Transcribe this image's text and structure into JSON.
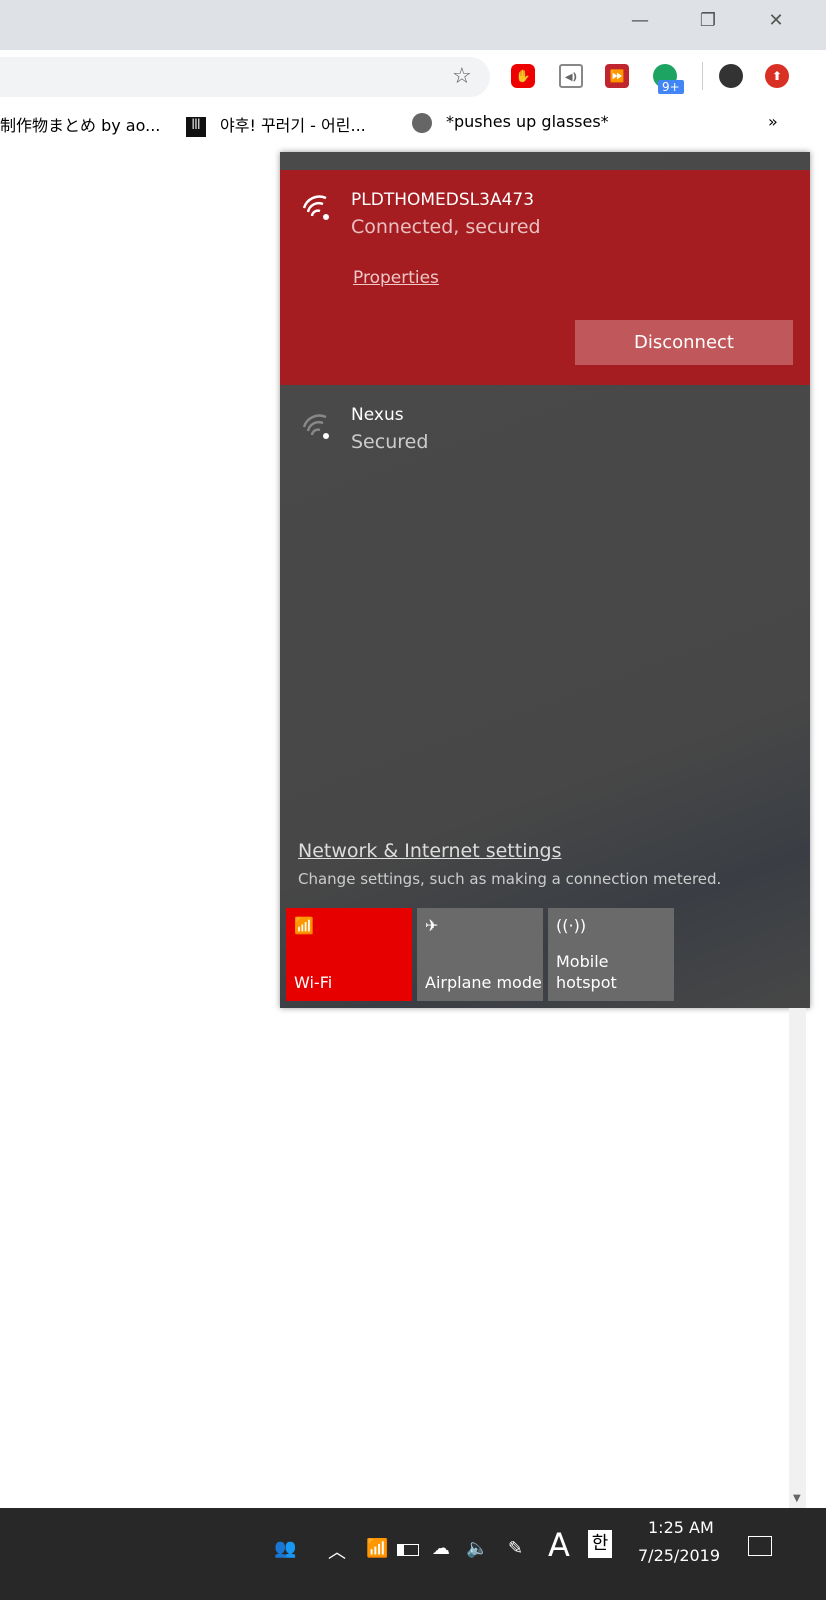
{
  "browser": {
    "window_controls": {
      "minimize": "—",
      "restore": "❐",
      "close": "✕"
    },
    "extensions": {
      "badge": "9+"
    },
    "bookmarks": [
      {
        "label": "制作物まとめ by ao..."
      },
      {
        "label": "야후! 꾸러기 - 어린..."
      },
      {
        "label": "*pushes up glasses*"
      }
    ],
    "bookmarks_overflow": "»"
  },
  "network_flyout": {
    "connected": {
      "ssid": "PLDTHOMEDSL3A473",
      "status": "Connected, secured",
      "properties": "Properties",
      "disconnect": "Disconnect"
    },
    "networks": [
      {
        "ssid": "Nexus",
        "status": "Secured"
      }
    ],
    "settings_link": "Network & Internet settings",
    "settings_desc": "Change settings, such as making a connection metered.",
    "quick_actions": [
      {
        "label": "Wi-Fi",
        "active": true
      },
      {
        "label": "Airplane mode",
        "active": false
      },
      {
        "label": "Mobile hotspot",
        "active": false
      }
    ],
    "accent": "#a51c21",
    "active_tile": "#e60000"
  },
  "taskbar": {
    "time": "1:25 AM",
    "date": "7/25/2019",
    "input_mode": "A",
    "ime": "한"
  }
}
